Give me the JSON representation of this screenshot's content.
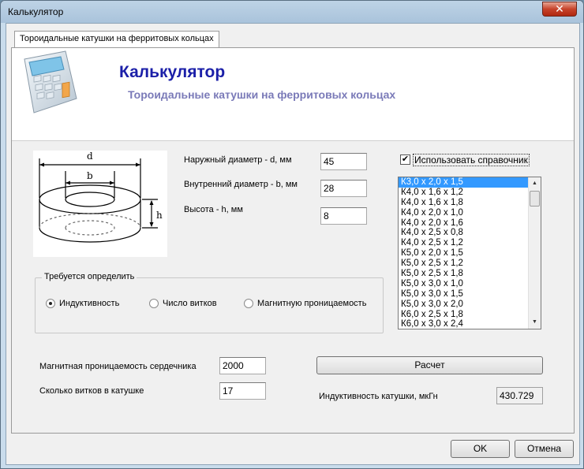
{
  "window": {
    "title": "Калькулятор",
    "close_label": "✕"
  },
  "tab": {
    "label": "Тороидальные катушки на ферритовых кольцах"
  },
  "header": {
    "title": "Калькулятор",
    "subtitle": "Тороидальные катушки на ферритовых кольцах"
  },
  "diagram": {
    "d": "d",
    "b": "b",
    "h": "h"
  },
  "dimensions": {
    "outer_label": "Наружный диаметр - d, мм",
    "outer_value": "45",
    "inner_label": "Внутренний диаметр - b, мм",
    "inner_value": "28",
    "height_label": "Высота - h, мм",
    "height_value": "8"
  },
  "reference": {
    "checkbox_label": "Использовать справочник",
    "checked": true,
    "items": [
      "К3,0 х 2,0 х 1,5",
      "К4,0 х 1,6 х 1,2",
      "К4,0 х 1,6 х 1,8",
      "К4,0 х 2,0 х 1,0",
      "К4,0 х 2,0 х 1,6",
      "К4,0 х 2,5 х 0,8",
      "К4,0 х 2,5 х 1,2",
      "К5,0 х 2,0 х 1,5",
      "К5,0 х 2,5 х 1,2",
      "К5,0 х 2,5 х 1,8",
      "К5,0 х 3,0 х 1,0",
      "К5,0 х 3,0 х 1,5",
      "К5,0 х 3,0 х 2,0",
      "К6,0 х 2,5 х 1,8",
      "К6,0 х 3,0 х 2,4"
    ],
    "selected_index": 0
  },
  "determine": {
    "title": "Требуется определить",
    "options": [
      "Индуктивность",
      "Число витков",
      "Магнитную проницаемость"
    ],
    "selected_index": 0
  },
  "inputs": {
    "permeability_label": "Магнитная проницаемость сердечника",
    "permeability_value": "2000",
    "turns_label": "Сколько витков в катушке",
    "turns_value": "17"
  },
  "calc": {
    "button_label": "Расчет",
    "result_label": "Индуктивность катушки, мкГн",
    "result_value": "430.729"
  },
  "footer": {
    "ok_label": "OK",
    "cancel_label": "Отмена"
  }
}
